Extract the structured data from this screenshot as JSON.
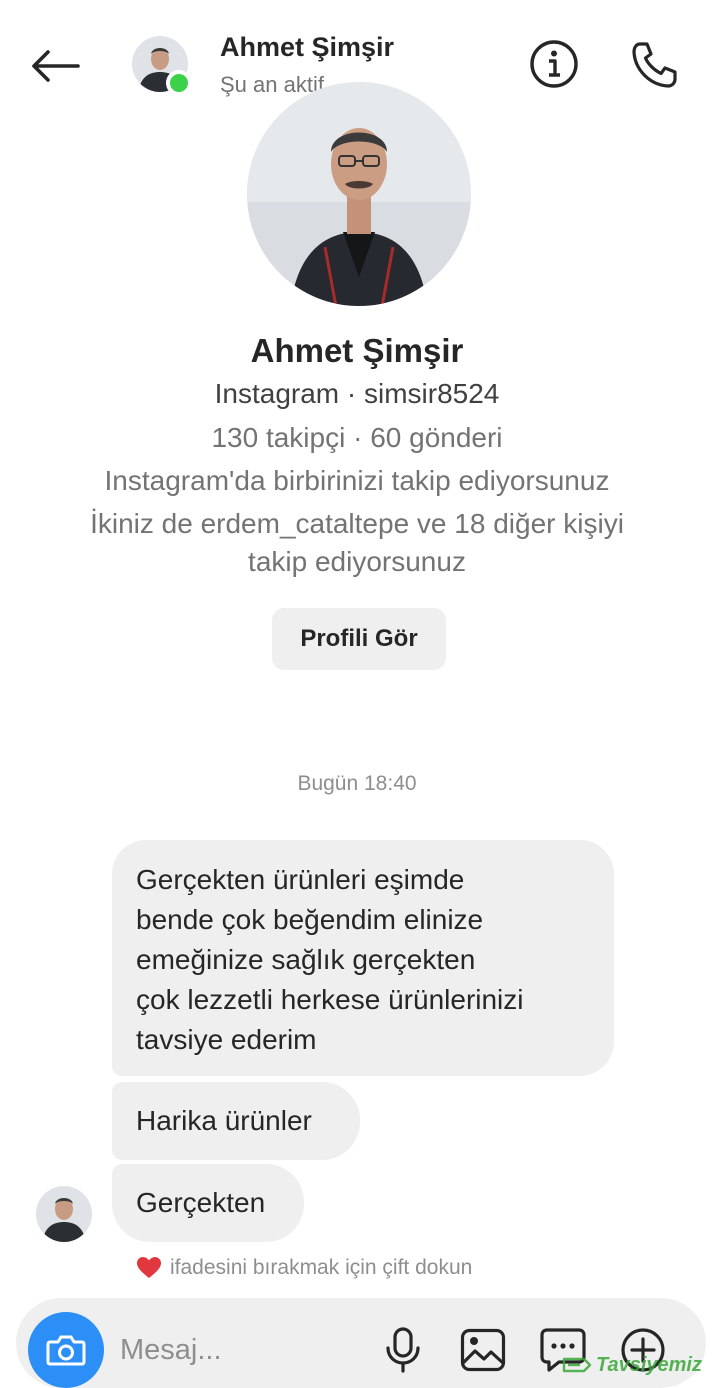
{
  "header": {
    "name": "Ahmet Şimşir",
    "status": "Şu an aktif"
  },
  "profile": {
    "name": "Ahmet Şimşir",
    "platform_line": "Instagram · simsir8524",
    "stats_line": "130 takipçi · 60 gönderi",
    "mutual_line": "Instagram'da birbirinizi takip ediyorsunuz",
    "common_line_1": "İkiniz de erdem_cataltepe ve 18 diğer kişiyi",
    "common_line_2": "takip ediyorsunuz",
    "view_profile_label": "Profili Gör"
  },
  "conversation": {
    "timestamp": "Bugün 18:40",
    "messages": [
      {
        "lines": [
          "Gerçekten ürünleri eşimde",
          "bende çok beğendim elinize",
          "emeğinize sağlık gerçekten",
          "çok lezzetli herkese ürünlerinizi",
          "tavsiye ederim"
        ]
      },
      {
        "text": "Harika ürünler"
      },
      {
        "text": "Gerçekten"
      }
    ],
    "reaction_hint": "ifadesini bırakmak için çift dokun"
  },
  "composer": {
    "placeholder": "Mesaj..."
  },
  "watermark": {
    "text": "Tavsiyemiz"
  },
  "icons": {
    "back": "arrow-left-icon",
    "info": "info-circle-icon",
    "call": "phone-icon",
    "camera": "camera-icon",
    "mic": "microphone-icon",
    "gallery": "image-icon",
    "sticker": "sticker-chat-icon",
    "plus": "plus-circle-icon",
    "heart": "heart-icon"
  },
  "colors": {
    "active": "#3bd24a",
    "camera_button": "#2b8ff7",
    "bubble": "#efefef",
    "heart": "#e0383e",
    "watermark": "#3aa83a"
  }
}
